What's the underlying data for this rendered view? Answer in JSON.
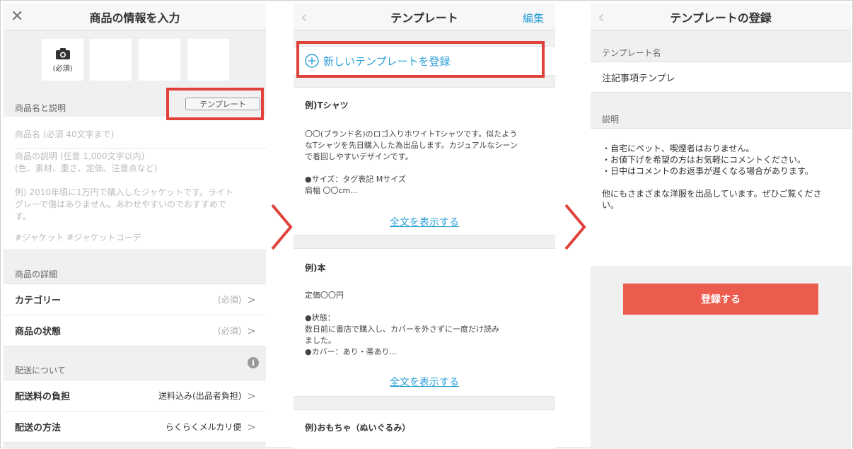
{
  "screen1": {
    "title": "商品の情報を入力",
    "photo_required": "(必須)",
    "template_button": "テンプレート",
    "name_section": "商品名と説明",
    "name_placeholder": "商品名 (必須 40文字まで)",
    "desc_placeholder_1": "商品の説明 (任意 1,000文字以内)",
    "desc_placeholder_2": "(色、素材、重さ、定価、注意点など)",
    "example_1": "例) 2010年頃に1万円で購入したジャケットです。ライト",
    "example_2": "グレーで傷はありません。あわせやすいのでおすすめで",
    "example_3": "す。",
    "hashtags": "#ジャケット #ジャケットコーデ",
    "detail_section": "商品の詳細",
    "category_label": "カテゴリー",
    "category_value": "(必須)",
    "condition_label": "商品の状態",
    "condition_value": "(必須)",
    "shipping_section": "配送について",
    "shipping_fee_label": "配送料の負担",
    "shipping_fee_value": "送料込み(出品者負担)",
    "shipping_method_label": "配送の方法",
    "shipping_method_value": "らくらくメルカリ便"
  },
  "screen2": {
    "title": "テンプレート",
    "edit": "編集",
    "new_template": "新しいテンプレートを登録",
    "card1_title": "例)Tシャツ",
    "card1_body": "〇〇(ブランド名)のロゴ入りホワイトTシャツです。似たよう\nなTシャツを先日購入した為出品します。カジュアルなシーン\nで着回しやすいデザインです。\n\n●サイズ：タグ表記 Mサイズ\n肩幅 〇〇cm...",
    "card1_link": "全文を表示する",
    "card2_title": "例)本",
    "card2_body": "定価〇〇円\n\n●状態：\n数日前に書店で購入し、カバーを外さずに一度だけ読み\nました。\n●カバー：あり・帯あり...",
    "card2_link": "全文を表示する",
    "card3_title": "例)おもちゃ（ぬいぐるみ）"
  },
  "screen3": {
    "title": "テンプレートの登録",
    "name_section": "テンプレート名",
    "name_value": "注記事項テンプレ",
    "desc_section": "説明",
    "desc_value": "・自宅にペット、喫煙者はおりません。\n・お値下げを希望の方はお気軽にコメントください。\n・日中はコメントのお返事が遅くなる場合があります。\n\n他にもさまざまな洋服を出品しています。ぜひご覧くださ\nい。",
    "submit": "登録する"
  },
  "colors": {
    "accent": "#2a9fd8",
    "highlight": "#e0413a",
    "submit": "#ec5c4e"
  }
}
